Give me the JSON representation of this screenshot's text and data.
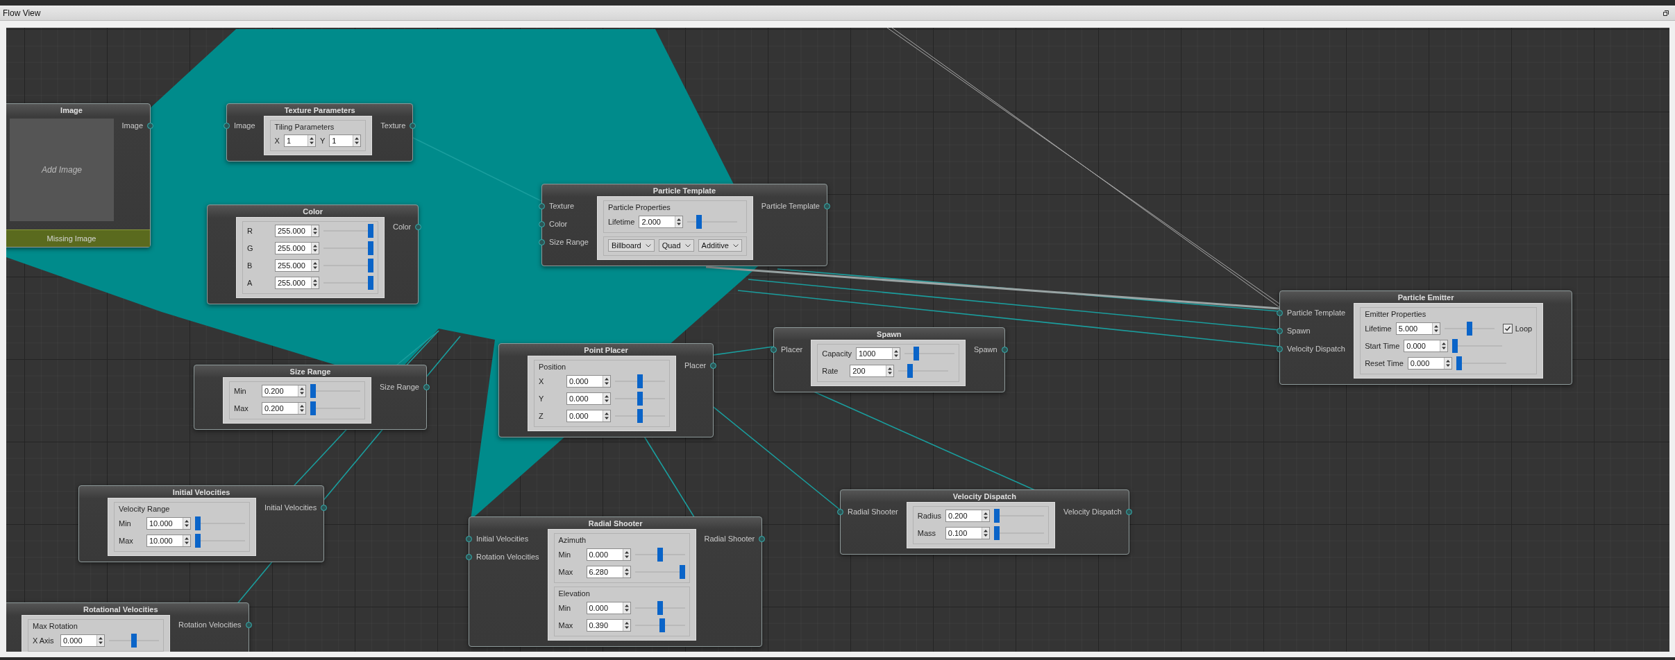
{
  "panel": {
    "title": "Flow View"
  },
  "nodes": [
    {
      "kind": "image",
      "title": "Image",
      "outputs": [
        "Image"
      ],
      "placeholder": "Add Image",
      "footer": "Missing Image"
    },
    {
      "kind": "panel",
      "title": "Texture Parameters",
      "inputs": [
        "Image"
      ],
      "outputs": [
        "Texture"
      ],
      "groups": [
        {
          "title": "Tiling Parameters",
          "rows": [
            {
              "kind": "pair",
              "fields": [
                {
                  "label": "X",
                  "value": "1"
                },
                {
                  "label": "Y",
                  "value": "1"
                }
              ]
            }
          ]
        }
      ]
    },
    {
      "kind": "panel",
      "title": "Particle Template",
      "inputs": [
        "Texture",
        "Color",
        "Size Range"
      ],
      "outputs": [
        "Particle Template"
      ],
      "groups": [
        {
          "title": "Particle Properties",
          "rows": [
            {
              "kind": "spin-slider",
              "label": "Lifetime",
              "value": "2.000",
              "level": 0.2
            }
          ]
        },
        {
          "rows": [
            {
              "kind": "dropdowns",
              "values": [
                "Billboard",
                "Quad",
                "Additive"
              ]
            }
          ]
        }
      ]
    },
    {
      "kind": "panel",
      "title": "Color",
      "outputs": [
        "Color"
      ],
      "groups": [
        {
          "rows": [
            {
              "kind": "spin-slider",
              "label": "R",
              "value": "255.000",
              "level": 1
            },
            {
              "kind": "spin-slider",
              "label": "G",
              "value": "255.000",
              "level": 1
            },
            {
              "kind": "spin-slider",
              "label": "B",
              "value": "255.000",
              "level": 1
            },
            {
              "kind": "spin-slider",
              "label": "A",
              "value": "255.000",
              "level": 1
            }
          ]
        }
      ]
    },
    {
      "kind": "panel",
      "title": "Particle Emitter",
      "inputs": [
        "Particle Template",
        "Spawn",
        "Velocity Dispatch"
      ],
      "groups": [
        {
          "title": "Emitter Properties",
          "rows": [
            {
              "kind": "spin-slider",
              "label": "Lifetime",
              "value": "5.000",
              "level": 0.5,
              "checkbox": {
                "label": "Loop",
                "checked": true
              }
            },
            {
              "kind": "spin-slider",
              "label": "Start Time",
              "value": "0.000",
              "level": 0
            },
            {
              "kind": "spin-slider",
              "label": "Reset Time",
              "value": "0.000",
              "level": 0
            }
          ]
        }
      ]
    },
    {
      "kind": "panel",
      "title": "Spawn",
      "inputs": [
        "Placer"
      ],
      "outputs": [
        "Spawn"
      ],
      "groups": [
        {
          "rows": [
            {
              "kind": "spin-slider",
              "label": "Capacity",
              "value": "1000",
              "level": 0.2
            },
            {
              "kind": "spin-slider",
              "label": "Rate",
              "value": "200",
              "level": 0.2
            }
          ]
        }
      ]
    },
    {
      "kind": "panel",
      "title": "Point Placer",
      "outputs": [
        "Placer"
      ],
      "groups": [
        {
          "title": "Position",
          "rows": [
            {
              "kind": "spin-slider",
              "label": "X",
              "value": "0.000",
              "level": 0.5
            },
            {
              "kind": "spin-slider",
              "label": "Y",
              "value": "0.000",
              "level": 0.5
            },
            {
              "kind": "spin-slider",
              "label": "Z",
              "value": "0.000",
              "level": 0.5
            }
          ]
        }
      ]
    },
    {
      "kind": "panel",
      "title": "Size Range",
      "outputs": [
        "Size Range"
      ],
      "groups": [
        {
          "rows": [
            {
              "kind": "spin-slider",
              "label": "Min",
              "value": "0.200",
              "level": 0
            },
            {
              "kind": "spin-slider",
              "label": "Max",
              "value": "0.200",
              "level": 0
            }
          ]
        }
      ]
    },
    {
      "kind": "panel",
      "title": "Initial Velocities",
      "outputs": [
        "Initial Velocities"
      ],
      "groups": [
        {
          "title": "Velocity Range",
          "rows": [
            {
              "kind": "spin-slider",
              "label": "Min",
              "value": "10.000",
              "level": 0
            },
            {
              "kind": "spin-slider",
              "label": "Max",
              "value": "10.000",
              "level": 0
            }
          ]
        }
      ]
    },
    {
      "kind": "panel",
      "title": "Velocity Dispatch",
      "inputs": [
        "Radial Shooter"
      ],
      "outputs": [
        "Velocity Dispatch"
      ],
      "groups": [
        {
          "rows": [
            {
              "kind": "spin-slider",
              "label": "Radius",
              "value": "0.200",
              "level": 0
            },
            {
              "kind": "spin-slider",
              "label": "Mass",
              "value": "0.100",
              "level": 0
            }
          ]
        }
      ]
    },
    {
      "kind": "panel",
      "title": "Radial Shooter",
      "inputs": [
        "Initial Velocities",
        "Rotation Velocities"
      ],
      "outputs": [
        "Radial Shooter"
      ],
      "groups": [
        {
          "title": "Azimuth",
          "rows": [
            {
              "kind": "spin-slider",
              "label": "Min",
              "value": "0.000",
              "level": 0.5
            },
            {
              "kind": "spin-slider",
              "label": "Max",
              "value": "6.280",
              "level": 1
            }
          ]
        },
        {
          "title": "Elevation",
          "rows": [
            {
              "kind": "spin-slider",
              "label": "Min",
              "value": "0.000",
              "level": 0.5
            },
            {
              "kind": "spin-slider",
              "label": "Max",
              "value": "0.390",
              "level": 0.55
            }
          ]
        }
      ]
    },
    {
      "kind": "panel",
      "title": "Rotational Velocities",
      "outputs": [
        "Rotation Velocities"
      ],
      "groups": [
        {
          "title": "Max Rotation",
          "rows": [
            {
              "kind": "spin-slider",
              "label": "X Axis",
              "value": "0.000",
              "level": 0.5
            }
          ]
        }
      ]
    }
  ]
}
